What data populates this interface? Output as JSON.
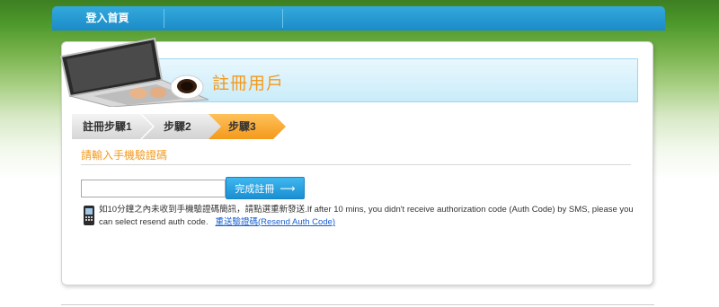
{
  "nav": {
    "items": [
      {
        "label": "登入首頁"
      }
    ]
  },
  "header": {
    "title": "註冊用戶"
  },
  "steps": [
    {
      "label": "註冊步驟1",
      "state": "done"
    },
    {
      "label": "步驟2",
      "state": "done"
    },
    {
      "label": "步驟3",
      "state": "active"
    }
  ],
  "form": {
    "section_label": "請輸入手機驗證碼",
    "auth_code_value": "",
    "submit_label": "完成註冊",
    "submit_arrow": "⟶"
  },
  "notice": {
    "text": "如10分鐘之內未收到手機驗證碼簡訊，請點選重新發送.If after 10 mins, you didn't receive authorization code (Auth Code) by SMS, please you can select resend auth code.",
    "resend_link": "重送驗證碼(Resend Auth Code)"
  },
  "colors": {
    "nav_blue": "#1b8bc8",
    "accent_orange": "#f29a1e",
    "button_blue": "#1a8fd3",
    "link_blue": "#1a5fd0"
  },
  "icons": {
    "phone": "mobile-phone-icon",
    "laptop": "laptop-illustration"
  }
}
